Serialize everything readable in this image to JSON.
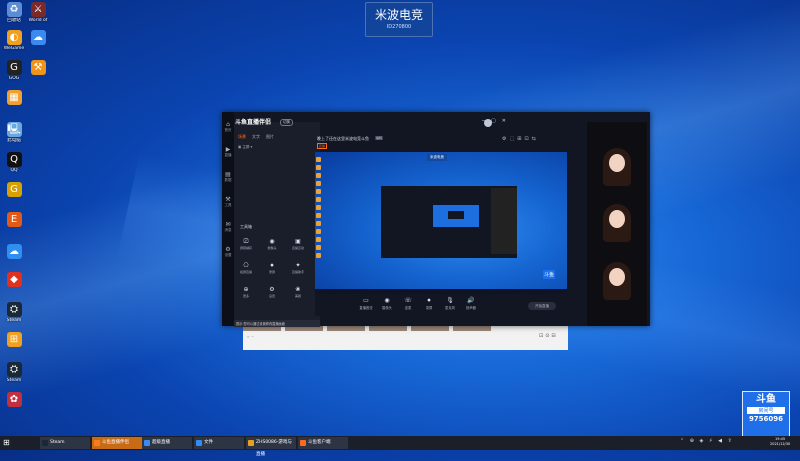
{
  "desktop": {
    "watermark": {
      "title": "米波电竞",
      "sub": "ID270800"
    },
    "icons": [
      {
        "label": "回收站",
        "glyph": "♻",
        "color": "#5b8cd6",
        "name": "recycle-bin-icon"
      },
      {
        "label": "World of",
        "glyph": "⚔",
        "color": "#7a2a2a",
        "name": "game-icon"
      },
      {
        "label": "WeGame",
        "glyph": "◐",
        "color": "#f0a020",
        "name": "wegame-icon"
      },
      {
        "label": "",
        "glyph": "☁",
        "color": "#3a8af0",
        "name": "cloud-icon"
      },
      {
        "label": "GOG",
        "glyph": "G",
        "color": "#222",
        "name": "gog-icon"
      },
      {
        "label": "",
        "glyph": "⚒",
        "color": "#f29418",
        "name": "tool-icon"
      },
      {
        "label": "",
        "glyph": "▦",
        "color": "#f1a030",
        "name": "grid-icon"
      },
      {
        "label": "此电脑",
        "glyph": "🖳",
        "color": "#6aa7e0",
        "name": "computer-icon"
      },
      {
        "label": "QQ",
        "glyph": "Q",
        "color": "#111",
        "name": "qq-icon"
      },
      {
        "label": "",
        "glyph": "G",
        "color": "#d8a000",
        "name": "garena-icon"
      },
      {
        "label": "",
        "glyph": "E",
        "color": "#e05a18",
        "name": "epic-icon"
      },
      {
        "label": "",
        "glyph": "☁",
        "color": "#2f8ef0",
        "name": "baidu-cloud-icon"
      },
      {
        "label": "",
        "glyph": "◆",
        "color": "#e03020",
        "name": "app-icon"
      },
      {
        "label": "Steam",
        "glyph": "⛭",
        "color": "#1b2838",
        "name": "steam-icon"
      },
      {
        "label": "",
        "glyph": "⊞",
        "color": "#f1a020",
        "name": "app2-icon"
      },
      {
        "label": "Steam",
        "glyph": "⛭",
        "color": "#1b2838",
        "name": "steam2-icon"
      },
      {
        "label": "",
        "glyph": "✿",
        "color": "#c03040",
        "name": "game2-icon"
      }
    ]
  },
  "app": {
    "logo": "斗鱼直播伴侣",
    "version": "切换",
    "tabs": [
      "场景",
      "文字",
      "图片"
    ],
    "scene_row": "主屏",
    "tools_title": "工具箱",
    "tools": [
      {
        "label": "屏幕捕获",
        "glyph": "⎚"
      },
      {
        "label": "摄像头",
        "glyph": "◉"
      },
      {
        "label": "直播互动",
        "glyph": "▣"
      },
      {
        "label": "截屏直播",
        "glyph": "⎔"
      },
      {
        "label": "录屏",
        "glyph": "⏺"
      },
      {
        "label": "直播助手",
        "glyph": "✦"
      },
      {
        "label": "更多",
        "glyph": "⊕"
      },
      {
        "label": "设置",
        "glyph": "⚙"
      },
      {
        "label": "美颜",
        "glyph": "❀"
      }
    ],
    "notice": "提示:您可以通过设置修改直播画面",
    "room_title": "晚上了还在这里米波电竞斗鱼",
    "room_badge": "编辑",
    "live_tag": "直播",
    "bottom": [
      {
        "label": "直播推流",
        "glyph": "▭"
      },
      {
        "label": "摄像头",
        "glyph": "◉"
      },
      {
        "label": "连麦",
        "glyph": "☏"
      },
      {
        "label": "录屏",
        "glyph": "⏺"
      },
      {
        "label": "麦克风",
        "glyph": "🎙"
      },
      {
        "label": "扬声器",
        "glyph": "🔊"
      }
    ],
    "golive": "开始直播",
    "sidebar": [
      {
        "label": "首页",
        "glyph": "⌂"
      },
      {
        "label": "直播",
        "glyph": "▶"
      },
      {
        "label": "数据",
        "glyph": "▤"
      },
      {
        "label": "工具",
        "glyph": "⚒"
      },
      {
        "label": "消息",
        "glyph": "✉"
      },
      {
        "label": "设置",
        "glyph": "⚙"
      }
    ]
  },
  "badge": {
    "top": "斗鱼",
    "mid": "房间号",
    "num": "9756096"
  },
  "taskbar": {
    "items": [
      {
        "label": "Steam",
        "color": "#1b2838",
        "state": "inactive"
      },
      {
        "label": "斗鱼直播伴侣",
        "color": "#ff7a1a",
        "state": "active"
      },
      {
        "label": "超级直播",
        "color": "#3a8af0",
        "state": "inactive"
      },
      {
        "label": "文件",
        "color": "#2f8ef0",
        "state": "inactive"
      },
      {
        "label": "ZHS0086-游戏与直播",
        "color": "#e6a020",
        "state": "inactive"
      },
      {
        "label": "斗鱼客户端",
        "color": "#ff6a1a",
        "state": "inactive"
      }
    ],
    "time": "19:45",
    "date": "2021/12/30"
  }
}
